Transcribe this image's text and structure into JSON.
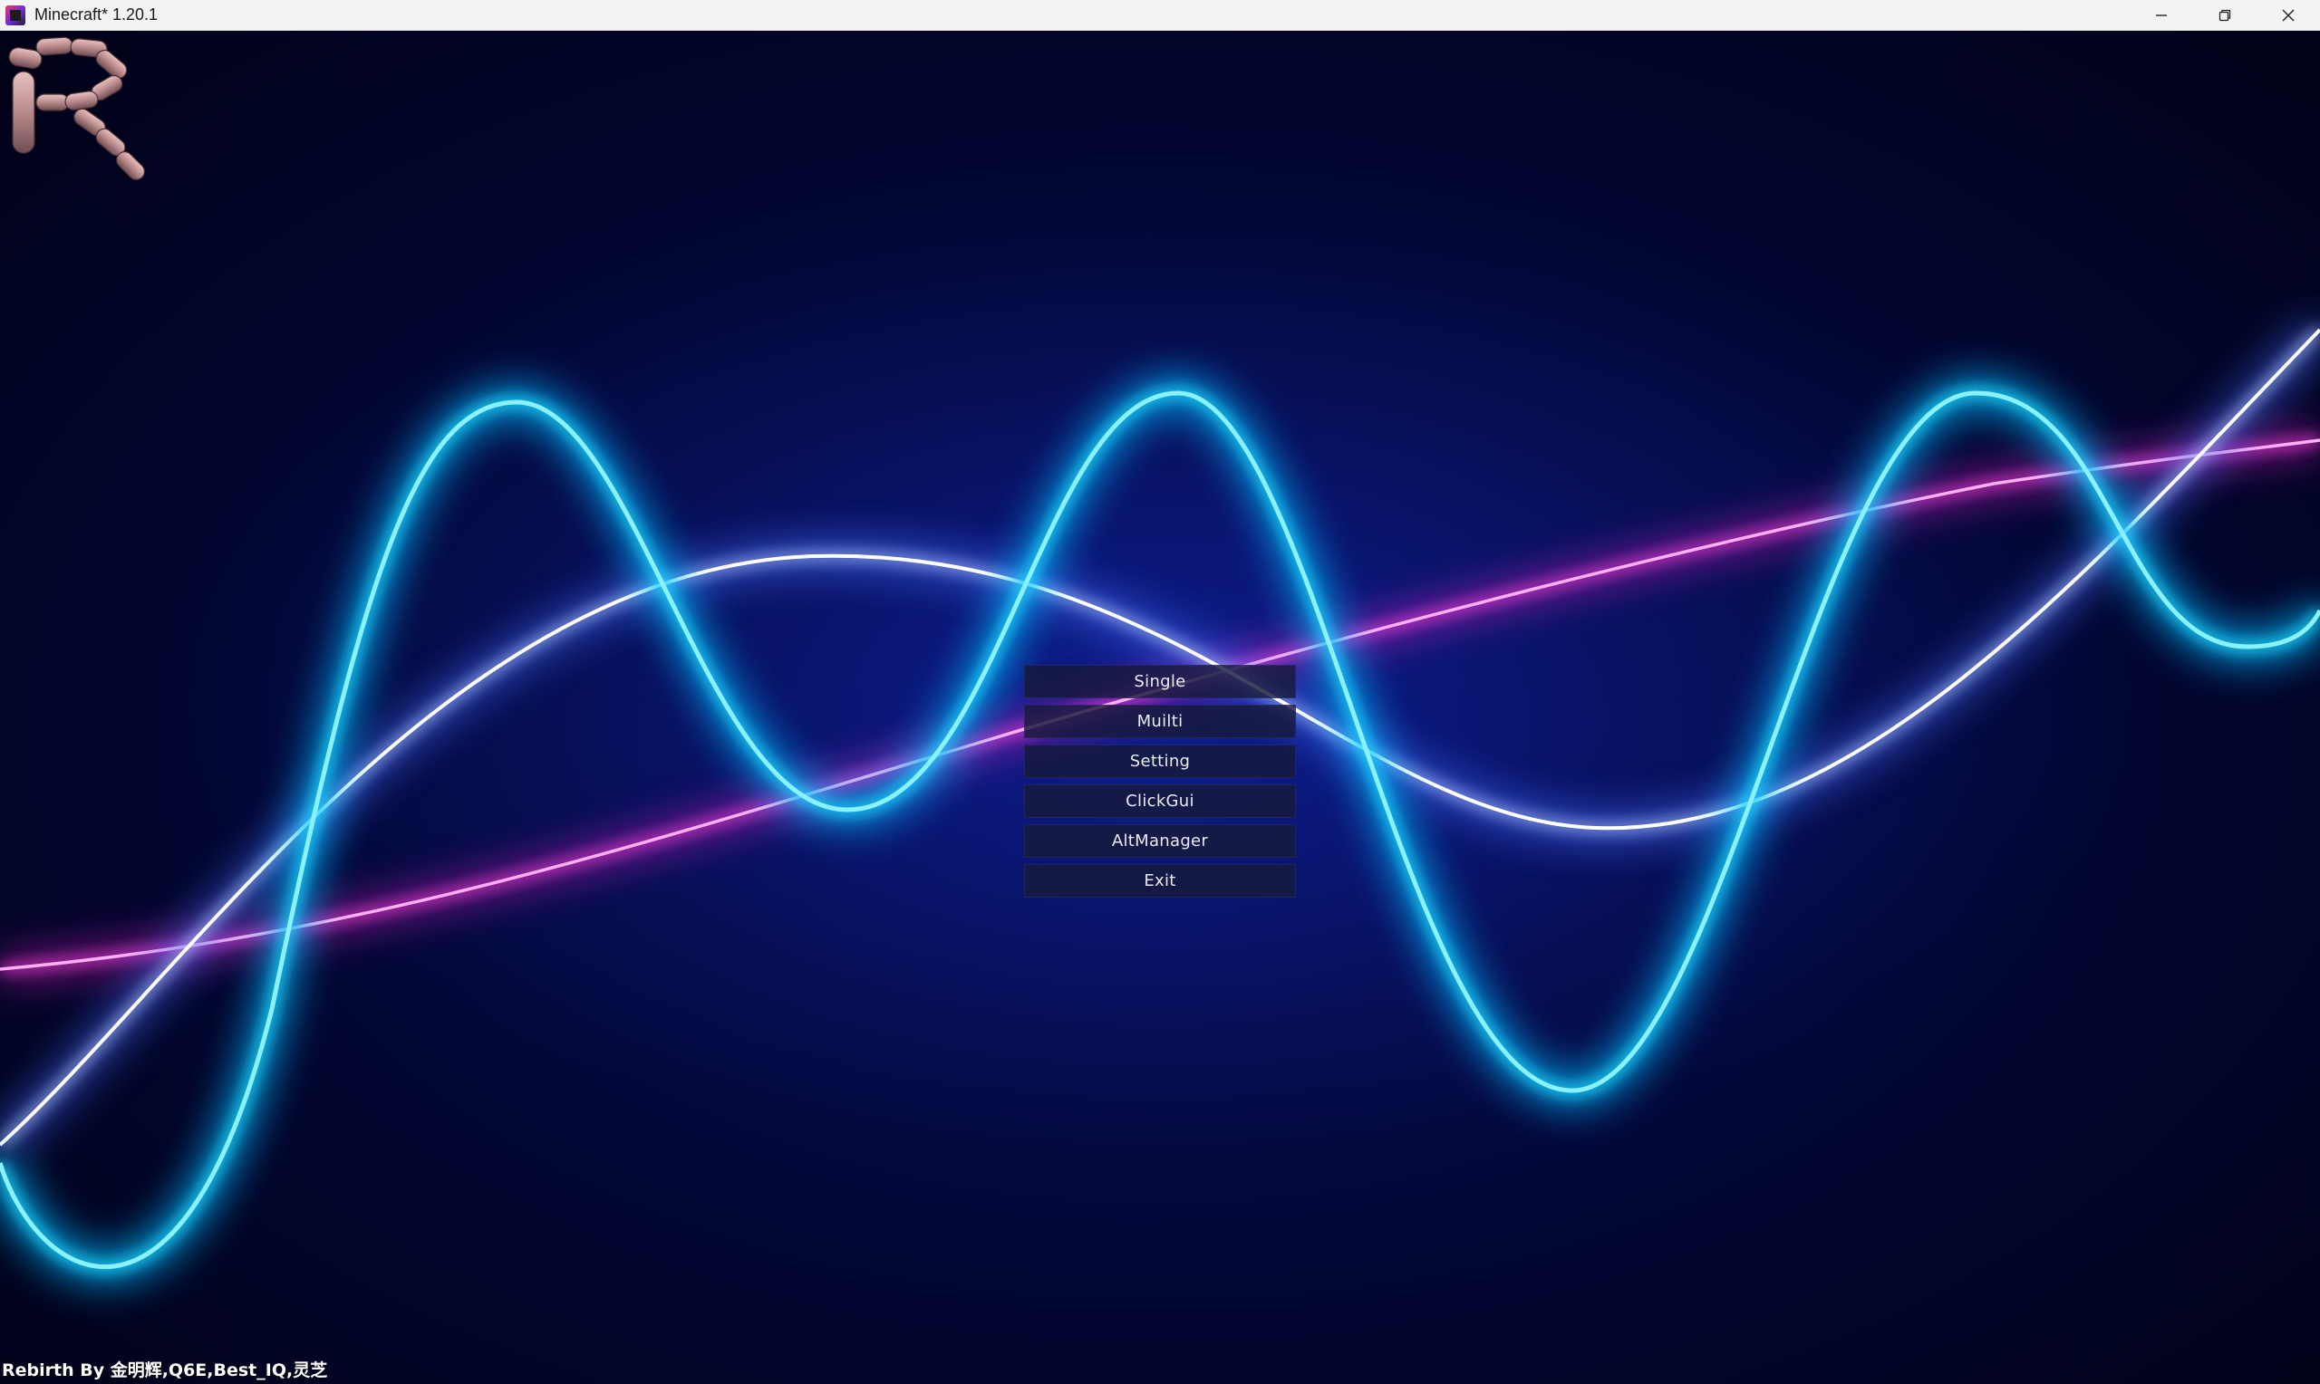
{
  "window": {
    "title": "Minecraft* 1.20.1",
    "controls": [
      "minimize-icon",
      "restore-icon",
      "close-icon"
    ]
  },
  "logo": {
    "letter": "R",
    "description_icon": "sausage-r-logo-icon"
  },
  "menu": {
    "items": [
      {
        "id": "single",
        "label": "Single"
      },
      {
        "id": "multi",
        "label": "Muilti"
      },
      {
        "id": "setting",
        "label": "Setting"
      },
      {
        "id": "clickgui",
        "label": "ClickGui"
      },
      {
        "id": "altmanager",
        "label": "AltManager"
      },
      {
        "id": "exit",
        "label": "Exit"
      }
    ]
  },
  "footer": {
    "credits": "Rebirth By 金明辉,Q6E,Best_IQ,灵芝"
  },
  "colors": {
    "cyan_wave": "#19d8ff",
    "white_wave": "#e8f0ff",
    "magenta_wave": "#ff2bd6",
    "background_core": "#0a1470",
    "button_bg": "#161a3a"
  }
}
